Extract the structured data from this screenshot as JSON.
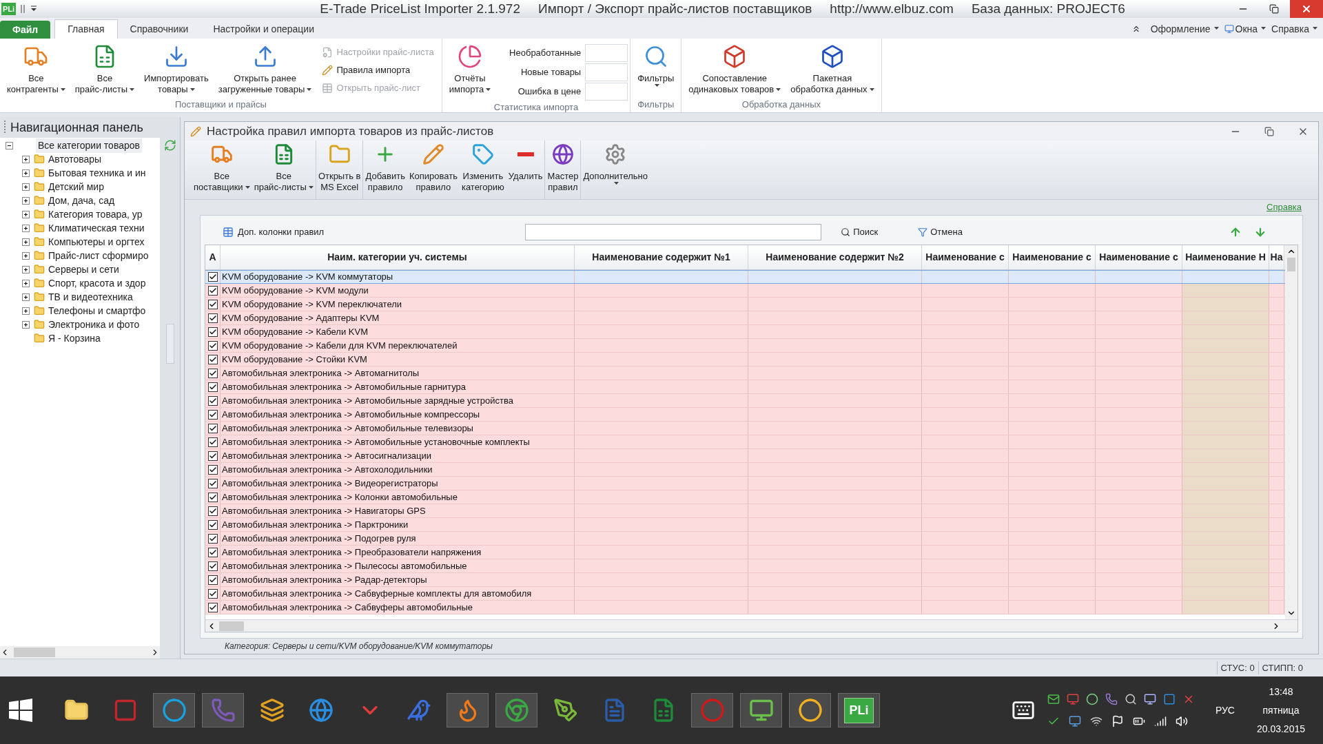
{
  "window": {
    "app_badge": "PLi",
    "title_parts": [
      "E-Trade PriceList Importer 2.1.972",
      "Импорт / Экспорт прайс-листов поставщиков",
      "http://www.elbuz.com",
      "База данных: PROJECT6"
    ]
  },
  "ribbon": {
    "tabs": [
      {
        "label": "Файл",
        "kind": "file",
        "selected": false
      },
      {
        "label": "Главная",
        "kind": "tab",
        "selected": true
      },
      {
        "label": "Справочники",
        "kind": "tab",
        "selected": false
      },
      {
        "label": "Настройки и операции",
        "kind": "tab",
        "selected": false
      }
    ],
    "right_menu": [
      {
        "label": "Оформление"
      },
      {
        "label": "Окна"
      },
      {
        "label": "Справка"
      }
    ],
    "groups": [
      {
        "label": "Поставщики и прайсы",
        "items": [
          {
            "kind": "large",
            "lines": [
              "Все",
              "контрагенты"
            ],
            "dropdown": true
          },
          {
            "kind": "large",
            "lines": [
              "Все",
              "прайс-листы"
            ],
            "dropdown": true
          },
          {
            "kind": "large",
            "lines": [
              "Импортировать",
              "товары"
            ],
            "dropdown": true
          },
          {
            "kind": "large",
            "lines": [
              "Открыть ранее",
              "загруженные товары"
            ],
            "dropdown": true
          },
          {
            "kind": "small_list",
            "entries": [
              {
                "label": "Настройки прайс-листа",
                "disabled": true
              },
              {
                "label": "Правила импорта",
                "disabled": false
              },
              {
                "label": "Открыть прайс-лист",
                "disabled": true
              }
            ]
          }
        ]
      },
      {
        "label": "Статистика импорта",
        "items": [
          {
            "kind": "large",
            "lines": [
              "Отчёты",
              "импорта"
            ],
            "dropdown": true
          },
          {
            "kind": "stats",
            "entries": [
              {
                "label": "Необработанные"
              },
              {
                "label": "Новые товары"
              },
              {
                "label": "Ошибка в цене"
              }
            ]
          }
        ]
      },
      {
        "label": "Фильтры",
        "items": [
          {
            "kind": "large",
            "lines": [
              "Фильтры"
            ],
            "dropdown": true
          }
        ]
      },
      {
        "label": "Обработка данных",
        "items": [
          {
            "kind": "large",
            "lines": [
              "Сопоставление",
              "одинаковых товаров"
            ],
            "dropdown": true
          },
          {
            "kind": "large",
            "lines": [
              "Пакетная",
              "обработка данных"
            ],
            "dropdown": true
          }
        ]
      }
    ]
  },
  "nav": {
    "title": "Навигационная панель",
    "root": {
      "label": "Все категории товаров",
      "expanded": true,
      "selected": true,
      "children": [
        {
          "label": "Автотовары",
          "kind": "group"
        },
        {
          "label": "Бытовая техника и ин",
          "kind": "group"
        },
        {
          "label": "Детский мир",
          "kind": "group"
        },
        {
          "label": "Дом, дача, сад",
          "kind": "group"
        },
        {
          "label": "Категория товара, ур",
          "kind": "group"
        },
        {
          "label": "Климатическая техни",
          "kind": "group"
        },
        {
          "label": "Компьютеры и оргтех",
          "kind": "group"
        },
        {
          "label": "Прайс-лист сформиро",
          "kind": "group"
        },
        {
          "label": "Серверы и сети",
          "kind": "group"
        },
        {
          "label": "Спорт, красота и здор",
          "kind": "group"
        },
        {
          "label": "ТВ и видеотехника",
          "kind": "group"
        },
        {
          "label": "Телефоны и смартфо",
          "kind": "group"
        },
        {
          "label": "Электроника и фото",
          "kind": "group"
        },
        {
          "label": "Я - Корзина",
          "kind": "leaf"
        }
      ]
    }
  },
  "rules_window": {
    "title": "Настройка правил импорта товаров из прайс-листов",
    "toolbar": [
      {
        "lines": [
          "Все",
          "поставщики"
        ],
        "dropdown": true
      },
      {
        "lines": [
          "Все",
          "прайс-листы"
        ],
        "dropdown": true
      },
      {
        "lines": [
          "Открыть в",
          "MS Excel"
        ],
        "dropdown": false
      },
      {
        "lines": [
          "Добавить",
          "правило"
        ],
        "dropdown": false
      },
      {
        "lines": [
          "Копировать",
          "правило"
        ],
        "dropdown": false
      },
      {
        "lines": [
          "Изменить",
          "категорию"
        ],
        "dropdown": false
      },
      {
        "lines": [
          "Удалить"
        ],
        "dropdown": false
      },
      {
        "lines": [
          "Мастер",
          "правил"
        ],
        "dropdown": false
      },
      {
        "lines": [
          "Дополнительно"
        ],
        "dropdown": true
      }
    ],
    "help_link": "Справка",
    "filter_bar": {
      "columns_button": "Доп. колонки правил",
      "search_button": "Поиск",
      "cancel_button": "Отмена"
    },
    "table": {
      "columns": [
        "A",
        "Наим. категории уч. системы",
        "Наименование содержит №1",
        "Наименование содержит №2",
        "Наименование с",
        "Наименование с",
        "Наименование с",
        "Наименование Н",
        "На"
      ],
      "rows": [
        {
          "name": "KVM оборудование -> KVM коммутаторы",
          "checked": true,
          "selected": true
        },
        {
          "name": "KVM оборудование -> KVM модули",
          "checked": true,
          "selected": false
        },
        {
          "name": "KVM оборудование -> KVM переключатели",
          "checked": true,
          "selected": false
        },
        {
          "name": "KVM оборудование -> Адаптеры KVM",
          "checked": true,
          "selected": false
        },
        {
          "name": "KVM оборудование -> Кабели KVM",
          "checked": true,
          "selected": false
        },
        {
          "name": "KVM оборудование -> Кабели для KVM переключателей",
          "checked": true,
          "selected": false
        },
        {
          "name": "KVM оборудование -> Стойки KVM",
          "checked": true,
          "selected": false
        },
        {
          "name": "Автомобильная электроника -> Автомагнитолы",
          "checked": true,
          "selected": false
        },
        {
          "name": "Автомобильная электроника -> Автомобильные гарнитура",
          "checked": true,
          "selected": false
        },
        {
          "name": "Автомобильная электроника -> Автомобильные зарядные устройства",
          "checked": true,
          "selected": false
        },
        {
          "name": "Автомобильная электроника -> Автомобильные компрессоры",
          "checked": true,
          "selected": false
        },
        {
          "name": "Автомобильная электроника -> Автомобильные телевизоры",
          "checked": true,
          "selected": false
        },
        {
          "name": "Автомобильная электроника -> Автомобильные установочные комплекты",
          "checked": true,
          "selected": false
        },
        {
          "name": "Автомобильная электроника -> Автосигнализации",
          "checked": true,
          "selected": false
        },
        {
          "name": "Автомобильная электроника -> Автохолодильники",
          "checked": true,
          "selected": false
        },
        {
          "name": "Автомобильная электроника -> Видеорегистраторы",
          "checked": true,
          "selected": false
        },
        {
          "name": "Автомобильная электроника -> Колонки автомобильные",
          "checked": true,
          "selected": false
        },
        {
          "name": "Автомобильная электроника -> Навигаторы GPS",
          "checked": true,
          "selected": false
        },
        {
          "name": "Автомобильная электроника -> Парктроники",
          "checked": true,
          "selected": false
        },
        {
          "name": "Автомобильная электроника -> Подогрев руля",
          "checked": true,
          "selected": false
        },
        {
          "name": "Автомобильная электроника -> Преобразователи напряжения",
          "checked": true,
          "selected": false
        },
        {
          "name": "Автомобильная электроника -> Пылесосы автомобильные",
          "checked": true,
          "selected": false
        },
        {
          "name": "Автомобильная электроника -> Радар-детекторы",
          "checked": true,
          "selected": false
        },
        {
          "name": "Автомобильная электроника -> Сабвуферные комплекты для автомобиля",
          "checked": true,
          "selected": false
        },
        {
          "name": "Автомобильная электроника -> Сабвуферы автомобильные",
          "checked": true,
          "selected": false
        }
      ]
    },
    "footer": "Категория: Серверы и сети/KVM оборудование/KVM коммутаторы"
  },
  "status_bar": [
    "СТУС: 0",
    "СТИПП: 0"
  ],
  "taskbar": {
    "apps": [
      {
        "running": false
      },
      {
        "running": false
      },
      {
        "running": true
      },
      {
        "running": true
      },
      {
        "running": false
      },
      {
        "running": false
      },
      {
        "running": false
      },
      {
        "running": false
      },
      {
        "running": true
      },
      {
        "running": true
      },
      {
        "running": false
      },
      {
        "running": false
      },
      {
        "running": false
      },
      {
        "running": true
      },
      {
        "running": true
      },
      {
        "running": true
      },
      {
        "running": true,
        "label": "PLi"
      }
    ],
    "language": "РУС",
    "time": "13:48",
    "weekday": "пятница",
    "date": "20.03.2015"
  }
}
